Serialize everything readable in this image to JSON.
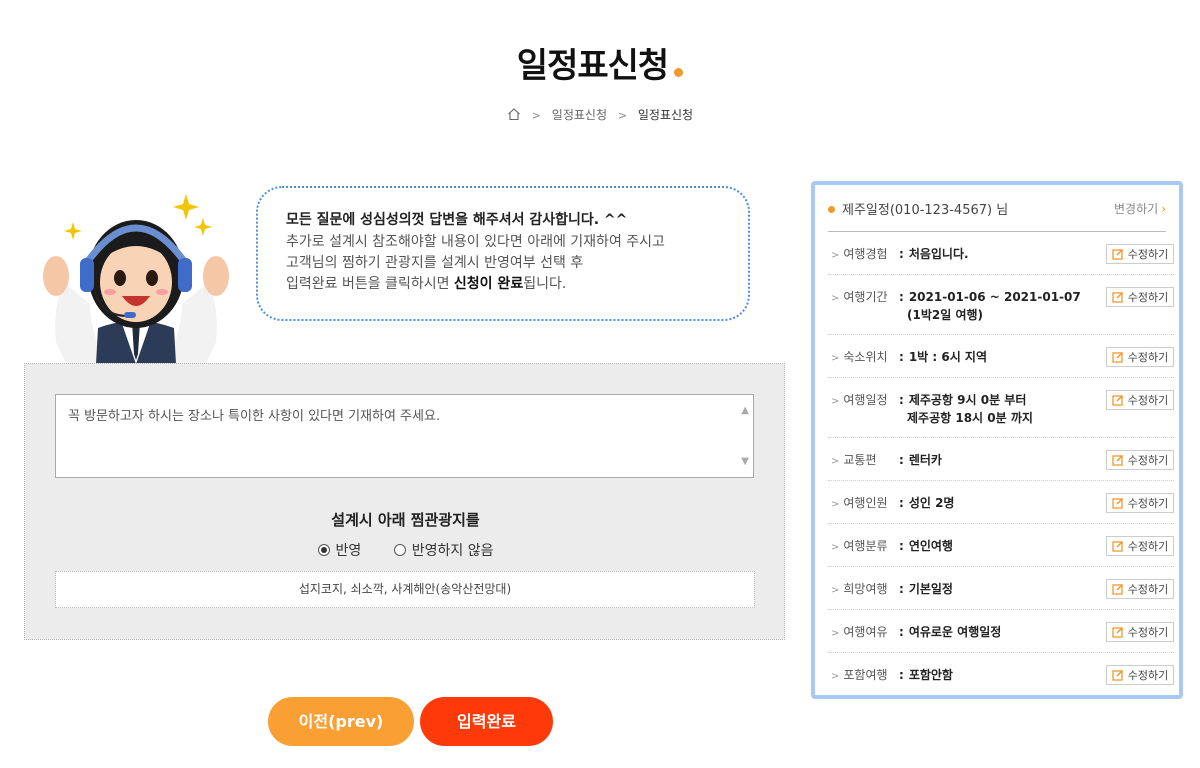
{
  "header": {
    "title": "일정표신청"
  },
  "breadcrumb": {
    "items": [
      "일정표신청",
      "일정표신청"
    ]
  },
  "bubble": {
    "line1": "모든 질문에 성심성의껏 답변을 해주셔서 감사합니다. ^^",
    "line2": "추가로 설계시 참조해야할 내용이 있다면 아래에 기재하여 주시고",
    "line3": "고객님의 찜하기 관광지를 설계시 반영여부 선택 후",
    "line4_pre": "입력완료 버튼을 클릭하시면 ",
    "line4_strong": "신청이 완료",
    "line4_post": "됩니다."
  },
  "form": {
    "memo_placeholder": "꼭 방문하고자 하시는 장소나 특이한 사항이 있다면 기재하여 주세요.",
    "reflect_title": "설계시 아래 찜관광지를",
    "option_yes": "반영",
    "option_no": "반영하지 않음",
    "selected": "반영",
    "spots": "섭지코지, 쇠소깍, 사계해안(송악산전망대)"
  },
  "buttons": {
    "prev": "이전(prev)",
    "submit": "입력완료"
  },
  "summary": {
    "name": "제주일정(010-123-4567) 님",
    "change_label": "변경하기",
    "edit_label": "수정하기",
    "rows": [
      {
        "label": "여행경험",
        "value": "처음입니다."
      },
      {
        "label": "여행기간",
        "value": "2021-01-06 ~ 2021-01-07",
        "value2": "(1박2일 여행)"
      },
      {
        "label": "숙소위치",
        "value": "1박 : 6시 지역"
      },
      {
        "label": "여행일정",
        "value": "제주공항 9시 0분 부터",
        "value2": "제주공항 18시 0분 까지"
      },
      {
        "label": "교통편",
        "value": "렌터카"
      },
      {
        "label": "여행인원",
        "value": "성인 2명"
      },
      {
        "label": "여행분류",
        "value": "연인여행"
      },
      {
        "label": "희망여행",
        "value": "기본일정"
      },
      {
        "label": "여행여유",
        "value": "여유로운 여행일정"
      },
      {
        "label": "포함여행",
        "value": "포함안함"
      }
    ]
  },
  "colors": {
    "accent_orange": "#f2992e",
    "submit_red": "#ff3a0a",
    "bubble_border": "#4b8fe0",
    "panel_border": "#a9c8f3"
  }
}
